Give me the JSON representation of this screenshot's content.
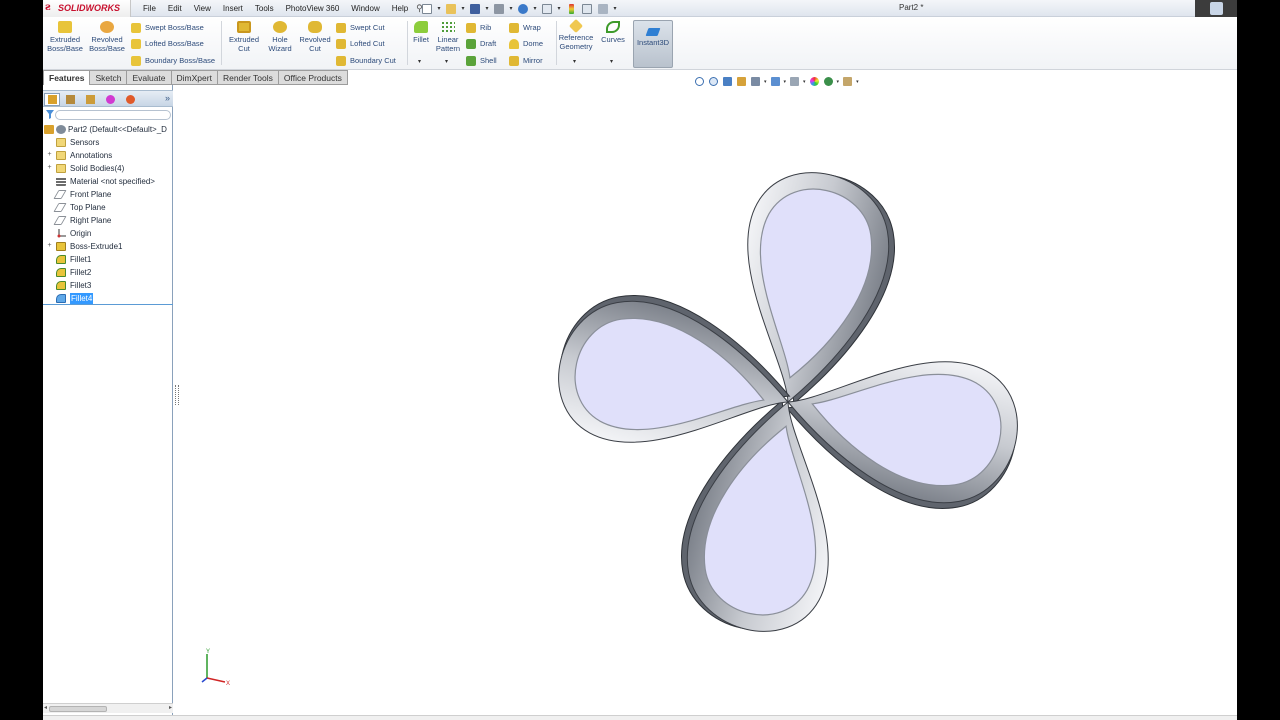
{
  "app": {
    "logo_text": "SOLIDWORKS",
    "document_title": "Part2 *"
  },
  "menu": [
    "File",
    "Edit",
    "View",
    "Insert",
    "Tools",
    "PhotoView 360",
    "Window",
    "Help"
  ],
  "quick_access_icons": [
    "new-document-icon",
    "open-folder-icon",
    "save-icon",
    "print-icon",
    "undo-icon",
    "select-arrow-icon",
    "rebuild-traffic-light-icon",
    "file-properties-icon",
    "options-icon"
  ],
  "command_manager": {
    "extruded_boss": [
      "Extruded",
      "Boss/Base"
    ],
    "revolved_boss": [
      "Revolved",
      "Boss/Base"
    ],
    "swept_boss": "Swept Boss/Base",
    "lofted_boss": "Lofted Boss/Base",
    "boundary_boss": "Boundary Boss/Base",
    "extruded_cut": [
      "Extruded",
      "Cut"
    ],
    "hole_wizard": [
      "Hole",
      "Wizard"
    ],
    "revolved_cut": [
      "Revolved",
      "Cut"
    ],
    "swept_cut": "Swept Cut",
    "lofted_cut": "Lofted Cut",
    "boundary_cut": "Boundary Cut",
    "fillet": "Fillet",
    "linear_pattern": [
      "Linear",
      "Pattern"
    ],
    "rib": "Rib",
    "draft": "Draft",
    "shell": "Shell",
    "wrap": "Wrap",
    "dome": "Dome",
    "mirror": "Mirror",
    "reference_geometry": [
      "Reference",
      "Geometry"
    ],
    "curves": "Curves",
    "instant3d": "Instant3D"
  },
  "tabs": [
    "Features",
    "Sketch",
    "Evaluate",
    "DimXpert",
    "Render Tools",
    "Office Products"
  ],
  "active_tab": "Features",
  "feature_tree": {
    "root": "Part2  (Default<<Default>_D",
    "items": [
      {
        "label": "Sensors",
        "icon": "sensors-folder-icon",
        "expandable": false
      },
      {
        "label": "Annotations",
        "icon": "annotations-icon",
        "expandable": true
      },
      {
        "label": "Solid Bodies(4)",
        "icon": "solid-bodies-folder-icon",
        "expandable": true
      },
      {
        "label": "Material <not specified>",
        "icon": "material-icon",
        "expandable": false
      },
      {
        "label": "Front Plane",
        "icon": "plane-icon",
        "expandable": false
      },
      {
        "label": "Top Plane",
        "icon": "plane-icon",
        "expandable": false
      },
      {
        "label": "Right Plane",
        "icon": "plane-icon",
        "expandable": false
      },
      {
        "label": "Origin",
        "icon": "origin-icon",
        "expandable": false
      },
      {
        "label": "Boss-Extrude1",
        "icon": "extrude-feature-icon",
        "expandable": true
      },
      {
        "label": "Fillet1",
        "icon": "fillet-feature-icon",
        "expandable": false
      },
      {
        "label": "Fillet2",
        "icon": "fillet-feature-icon",
        "expandable": false
      },
      {
        "label": "Fillet3",
        "icon": "fillet-feature-icon",
        "expandable": false
      },
      {
        "label": "Fillet4",
        "icon": "fillet-feature-icon",
        "expandable": false
      }
    ],
    "selected": "Fillet4"
  },
  "hud_icons": [
    "zoom-to-fit-icon",
    "zoom-area-icon",
    "previous-view-icon",
    "section-view-icon",
    "view-orientation-icon",
    "display-style-icon",
    "hide-show-items-icon",
    "edit-appearance-icon",
    "apply-scene-icon",
    "view-settings-icon"
  ],
  "model": {
    "description": "four-petal filleted solid",
    "petal_count": 4,
    "face_color": "#e0e0fa",
    "edge_color": "#8a8f99"
  },
  "triad": {
    "x": "X",
    "y": "Y"
  },
  "colors": {
    "accent": "#2d4b7a",
    "selection": "#3399ff",
    "brand": "#c8102e"
  }
}
